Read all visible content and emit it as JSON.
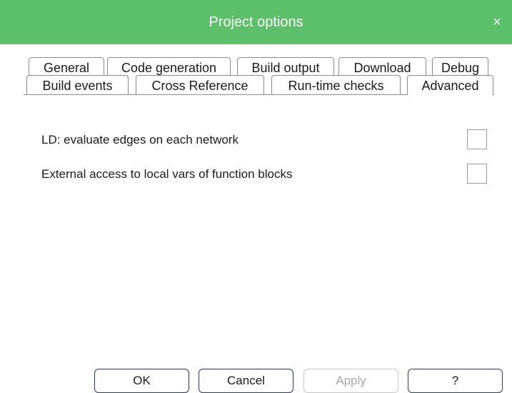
{
  "window": {
    "title": "Project options",
    "close_glyph": "×",
    "close_icon": "close-icon"
  },
  "tabs": {
    "row1": [
      {
        "label": "General"
      },
      {
        "label": "Code generation"
      },
      {
        "label": "Build output"
      },
      {
        "label": "Download"
      },
      {
        "label": "Debug"
      }
    ],
    "row2": [
      {
        "label": "Build events"
      },
      {
        "label": "Cross Reference"
      },
      {
        "label": "Run-time checks"
      },
      {
        "label": "Advanced",
        "active": true
      }
    ]
  },
  "options": [
    {
      "label": "LD: evaluate edges on each network",
      "checked": false
    },
    {
      "label": "External access to local vars of function blocks",
      "checked": false
    }
  ],
  "buttons": {
    "ok": "OK",
    "cancel": "Cancel",
    "apply": "Apply",
    "help": "?"
  },
  "colors": {
    "titlebar": "#5cc06a",
    "button_border": "#2a3a6a",
    "disabled_text": "#a8a8a8"
  }
}
